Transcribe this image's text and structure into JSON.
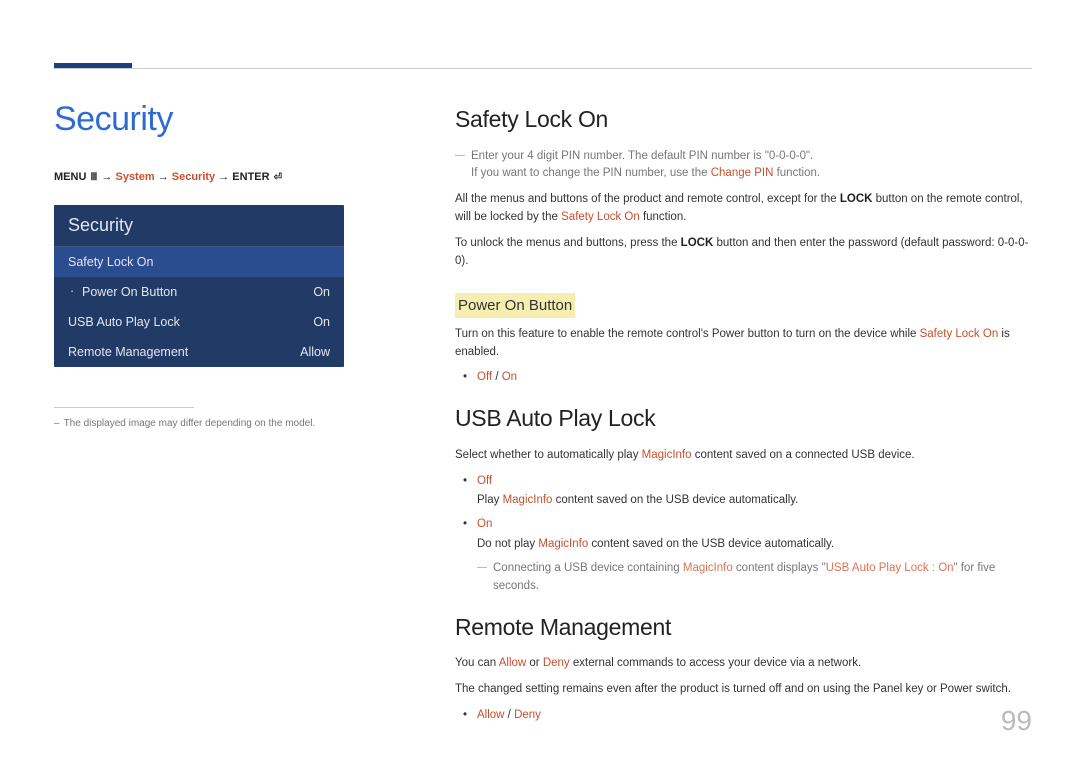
{
  "page_number": "99",
  "left": {
    "title": "Security",
    "breadcrumb": {
      "menu": "MENU",
      "arrow": "→",
      "system": "System",
      "security": "Security",
      "enter": "ENTER"
    },
    "panel": {
      "header": "Security",
      "rows": [
        {
          "label": "Safety Lock On",
          "value": "",
          "em": true,
          "indent": false
        },
        {
          "label": "Power On Button",
          "value": "On",
          "em": false,
          "indent": true
        },
        {
          "label": "USB Auto Play Lock",
          "value": "On",
          "em": false,
          "indent": false
        },
        {
          "label": "Remote Management",
          "value": "Allow",
          "em": false,
          "indent": false
        }
      ]
    },
    "footnote": "The displayed image may differ depending on the model."
  },
  "right": {
    "safety_lock": {
      "heading": "Safety Lock On",
      "note1_a": "Enter your 4 digit PIN number. The default PIN number is \"0-0-0-0\".",
      "note1_b_pre": "If you want to change the PIN number, use the ",
      "note1_b_accent": "Change PIN",
      "note1_b_post": " function.",
      "p1_pre": "All the menus and buttons of the product and remote control, except for the ",
      "p1_bold": "LOCK",
      "p1_mid": " button on the remote control, will be locked by the ",
      "p1_accent": "Safety Lock On",
      "p1_post": " function.",
      "p2_pre": "To unlock the menus and buttons, press the ",
      "p2_bold": "LOCK",
      "p2_post": " button and then enter the password (default password: 0-0-0-0).",
      "power_on": {
        "heading": "Power On Button",
        "p_pre": "Turn on this feature to enable the remote control's Power button to turn on the device while ",
        "p_accent": "Safety Lock On",
        "p_post": " is enabled.",
        "opt_off": "Off",
        "opt_sep": " / ",
        "opt_on": "On"
      }
    },
    "usb": {
      "heading": "USB Auto Play Lock",
      "p_pre": "Select whether to automatically play ",
      "p_accent": "MagicInfo",
      "p_post": " content saved on a connected USB device.",
      "opt_off": "Off",
      "off_sub_pre": "Play ",
      "off_sub_accent": "MagicInfo",
      "off_sub_post": " content saved on the USB device automatically.",
      "opt_on": "On",
      "on_sub_pre": "Do not play ",
      "on_sub_accent": "MagicInfo",
      "on_sub_post": " content saved on the USB device automatically.",
      "note_pre": "Connecting a USB device containing ",
      "note_accent1": "MagicInfo",
      "note_mid": " content displays \"",
      "note_accent2": "USB Auto Play Lock : On",
      "note_post": "\" for five seconds."
    },
    "remote": {
      "heading": "Remote Management",
      "p1_pre": "You can ",
      "p1_allow": "Allow",
      "p1_mid": " or ",
      "p1_deny": "Deny",
      "p1_post": " external commands to access your device via a network.",
      "p2": "The changed setting remains even after the product is turned off and on using the Panel key or Power switch.",
      "opt_allow": "Allow",
      "opt_sep": " / ",
      "opt_deny": "Deny"
    }
  }
}
